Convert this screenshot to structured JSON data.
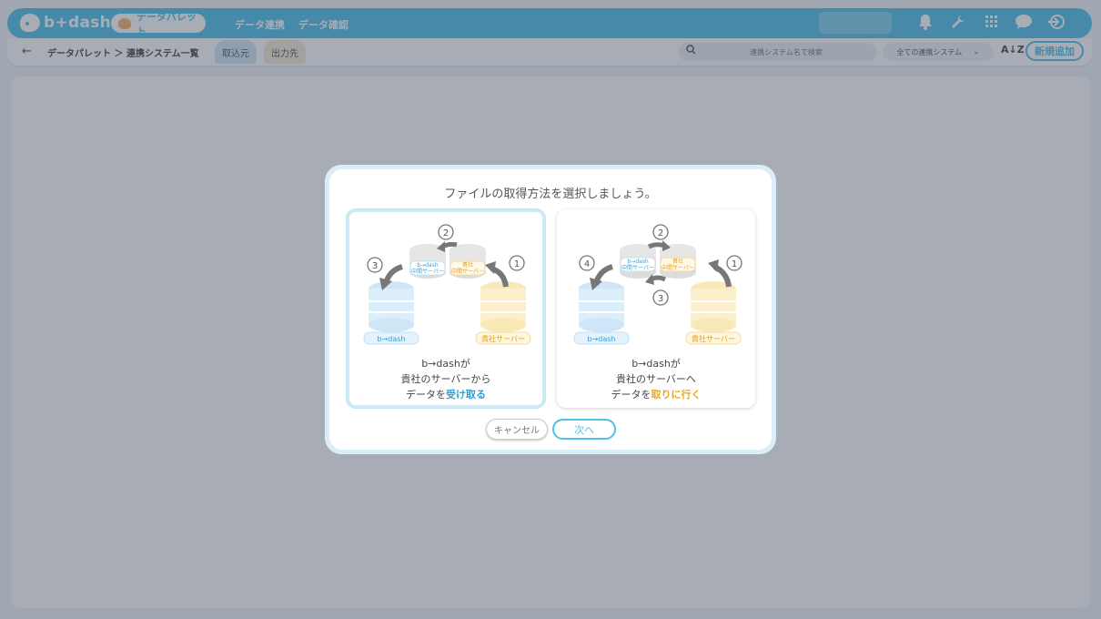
{
  "header": {
    "logo_text": "b+dash",
    "current_module": "データパレット",
    "nav": [
      "データ連携",
      "データ確認"
    ]
  },
  "subheader": {
    "breadcrumb": "データパレット ＞ 連携システム一覧",
    "tabs": [
      "取込元",
      "出力先"
    ],
    "search_placeholder": "連携システム名で検索",
    "filter_value": "全ての連携システム",
    "sort_label": "A↓Z",
    "new_button": "新規追加"
  },
  "modal": {
    "title": "ファイルの取得方法を選択しましょう。",
    "options": [
      {
        "id": "receive",
        "line1": "b→dashが",
        "line2": "貴社のサーバーから",
        "line3_prefix": "データを",
        "line3_highlight": "受け取る",
        "diagram": {
          "step_numbers": [
            "1",
            "2",
            "3"
          ],
          "bdash_label": "b→dash",
          "client_label": "貴社サーバー",
          "relay_bdash_label": [
            "b→dash",
            "中間サーバー"
          ],
          "relay_client_label": [
            "貴社",
            "中間サーバー"
          ]
        }
      },
      {
        "id": "fetch",
        "line1": "b→dashが",
        "line2": "貴社のサーバーへ",
        "line3_prefix": "データを",
        "line3_highlight": "取りに行く",
        "diagram": {
          "step_numbers": [
            "1",
            "2",
            "3",
            "4"
          ],
          "bdash_label": "b→dash",
          "client_label": "貴社サーバー",
          "relay_bdash_label": [
            "b→dash",
            "中間サーバー"
          ],
          "relay_client_label": [
            "貴社",
            "中間サーバー"
          ]
        }
      }
    ],
    "cancel_label": "キャンセル",
    "next_label": "次へ"
  },
  "colors": {
    "brand": "#4fc0e8",
    "highlight_blue": "#2ba3da",
    "highlight_yellow": "#eba821"
  }
}
